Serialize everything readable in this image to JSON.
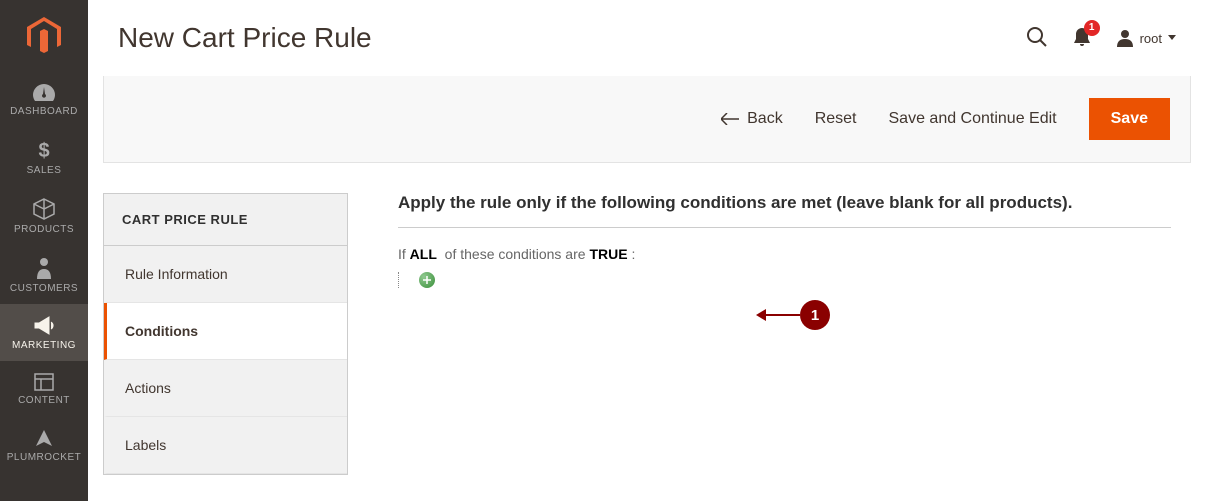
{
  "sidebar": {
    "items": [
      {
        "label": "DASHBOARD"
      },
      {
        "label": "SALES"
      },
      {
        "label": "PRODUCTS"
      },
      {
        "label": "CUSTOMERS"
      },
      {
        "label": "MARKETING"
      },
      {
        "label": "CONTENT"
      },
      {
        "label": "PLUMROCKET"
      }
    ]
  },
  "header": {
    "title": "New Cart Price Rule",
    "notif_count": "1",
    "user_name": "root"
  },
  "actionbar": {
    "back": "Back",
    "reset": "Reset",
    "save_continue": "Save and Continue Edit",
    "save": "Save"
  },
  "tabs": {
    "header": "CART PRICE RULE",
    "items": [
      {
        "label": "Rule Information"
      },
      {
        "label": "Conditions"
      },
      {
        "label": "Actions"
      },
      {
        "label": "Labels"
      }
    ]
  },
  "panel": {
    "title": "Apply the rule only if the following conditions are met (leave blank for all products).",
    "cond_prefix": "If ",
    "cond_aggregator": "ALL",
    "cond_middle": " of these conditions are ",
    "cond_value": "TRUE",
    "cond_suffix": " :"
  },
  "callout": {
    "num": "1"
  }
}
